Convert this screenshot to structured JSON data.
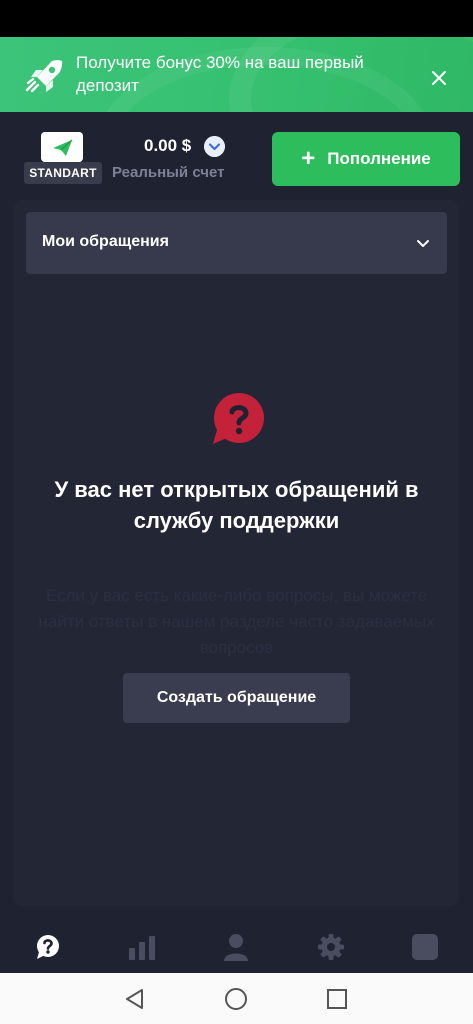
{
  "banner": {
    "text": "Получите бонус 30% на ваш первый депозит",
    "icon": "rocket-icon",
    "close_icon": "close-icon"
  },
  "account": {
    "badge": "STANDART",
    "balance": "0.00 $",
    "type": "Реальный счет"
  },
  "deposit_button": {
    "label": "Пополнение"
  },
  "tickets_dropdown": {
    "label": "Мои обращения"
  },
  "empty_state": {
    "title": "У вас нет открытых обращений в службу поддержки",
    "description": "Если у вас есть какие-либо вопросы, вы можете найти ответы в нашем разделе часто задаваемых вопросов",
    "button": "Создать обращение"
  },
  "tabbar": {
    "items": [
      {
        "icon": "support-icon",
        "active": true
      },
      {
        "icon": "chart-icon",
        "active": false
      },
      {
        "icon": "profile-icon",
        "active": false
      },
      {
        "icon": "settings-icon",
        "active": false
      },
      {
        "icon": "square-icon",
        "active": false
      }
    ]
  },
  "system_nav": {
    "buttons": [
      "back-icon",
      "home-icon",
      "recents-icon"
    ]
  },
  "colors": {
    "accent_green": "#2ebd5c",
    "banner_green": "#38c06f",
    "background": "#1f2230",
    "panel": "#232635",
    "question_red": "#c4213a"
  }
}
